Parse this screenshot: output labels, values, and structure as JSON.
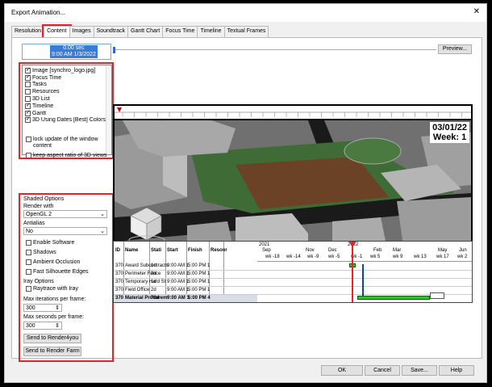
{
  "window": {
    "title": "Export Animation...",
    "close_glyph": "✕"
  },
  "tabs": [
    "Resolution",
    "Content",
    "Images",
    "Soundtrack",
    "Gantt Chart",
    "Focus Time",
    "Timeline",
    "Textual Frames"
  ],
  "time": {
    "line1": "0.00 sec",
    "line2": "9:00 AM 1/3/2022"
  },
  "preview_label": "Preview...",
  "content_list": [
    {
      "label": "Image [synchro_logo.jpg]",
      "checked": true
    },
    {
      "label": "Focus Time",
      "checked": true
    },
    {
      "label": "Tasks",
      "checked": false
    },
    {
      "label": "Resources",
      "checked": false
    },
    {
      "label": "3D List",
      "checked": false
    },
    {
      "label": "Timeline",
      "checked": true
    },
    {
      "label": "Gantt",
      "checked": true
    },
    {
      "label": "3D Using Dates [Best] Colors |",
      "checked": true
    }
  ],
  "options": {
    "lock_update": "lock update of the window content",
    "keep_aspect": "keep aspect ratio of 3D views"
  },
  "shaded": {
    "heading": "Shaded Options",
    "render_with_label": "Render with",
    "render_with_value": "OpenGL 2",
    "antialias_label": "Antialias",
    "antialias_value": "No",
    "enable_software": "Enable Software",
    "shadows": "Shadows",
    "ambient": "Ambient Occlusion",
    "silhouette": "Fast Silhouette Edges"
  },
  "ray": {
    "heading": "Iray Options",
    "raytrace": "Raytrace with Iray",
    "max_iter_label": "Max iterations per frame:",
    "max_iter_value": "300",
    "max_sec_label": "Max seconds per frame:",
    "max_sec_value": "300",
    "send_r4u": "Send to Render4you",
    "send_farm": "Send to Render Farm"
  },
  "viewer": {
    "date": "03/01/22",
    "week": "Week: 1"
  },
  "gantt": {
    "headers": [
      "ID",
      "Name",
      "Stati",
      "Start",
      "Finish",
      "Resour"
    ],
    "rows": [
      {
        "id": "370",
        "name": "Award Subcontracts",
        "dur": "1d",
        "start": "9:00 AM 1",
        "finish": "5:00 PM 1"
      },
      {
        "id": "370",
        "name": "Perimeter Fence",
        "dur": "3d",
        "start": "9:00 AM 1",
        "finish": "5:00 PM 1"
      },
      {
        "id": "370",
        "name": "Temporary Hard St",
        "dur": "1d",
        "start": "9:00 AM 1",
        "finish": "5:00 PM 1"
      },
      {
        "id": "370",
        "name": "Field Office",
        "dur": "2d",
        "start": "9:00 AM 1",
        "finish": "5:00 PM 1"
      },
      {
        "id": "370",
        "name": "Material Procurem",
        "dur": "70d",
        "start": "9:00 AM 1",
        "finish": "5:00 PM 4"
      }
    ],
    "year_left": "2021",
    "year_right": "2022",
    "months": [
      "Sep",
      "Nov",
      "Dec",
      "Feb",
      "Mar",
      "May",
      "Jun"
    ],
    "weeks": [
      "wk -18",
      "wk -14",
      "wk -9",
      "wk -5",
      "wk -1",
      "wk 5",
      "wk 9",
      "wk 13",
      "wk 17",
      "wk 2"
    ]
  },
  "buttons": {
    "ok": "OK",
    "cancel": "Cancel",
    "save": "Save...",
    "help": "Help"
  }
}
